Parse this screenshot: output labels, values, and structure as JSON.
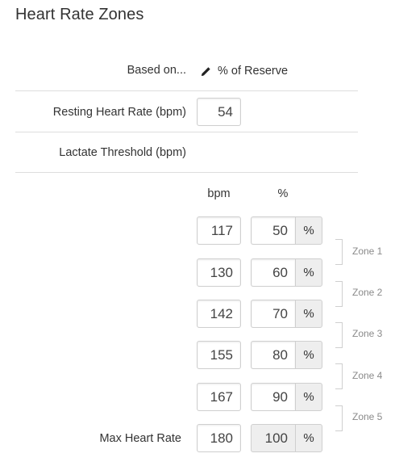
{
  "page": {
    "title": "Heart Rate Zones"
  },
  "settings": {
    "based_on_label": "Based on...",
    "based_on_value": "% of Reserve",
    "resting_label": "Resting Heart Rate (bpm)",
    "resting_value": "54",
    "lactate_label": "Lactate Threshold (bpm)"
  },
  "table": {
    "bpm_header": "bpm",
    "pct_header": "%",
    "pct_unit": "%",
    "rows": [
      {
        "bpm": "117",
        "pct": "50"
      },
      {
        "bpm": "130",
        "pct": "60"
      },
      {
        "bpm": "142",
        "pct": "70"
      },
      {
        "bpm": "155",
        "pct": "80"
      },
      {
        "bpm": "167",
        "pct": "90"
      }
    ],
    "max": {
      "label": "Max Heart Rate",
      "bpm": "180",
      "pct": "100"
    }
  },
  "zones": [
    "Zone 1",
    "Zone 2",
    "Zone 3",
    "Zone 4",
    "Zone 5"
  ],
  "icons": {
    "based_on_edit": "pencil-icon"
  }
}
